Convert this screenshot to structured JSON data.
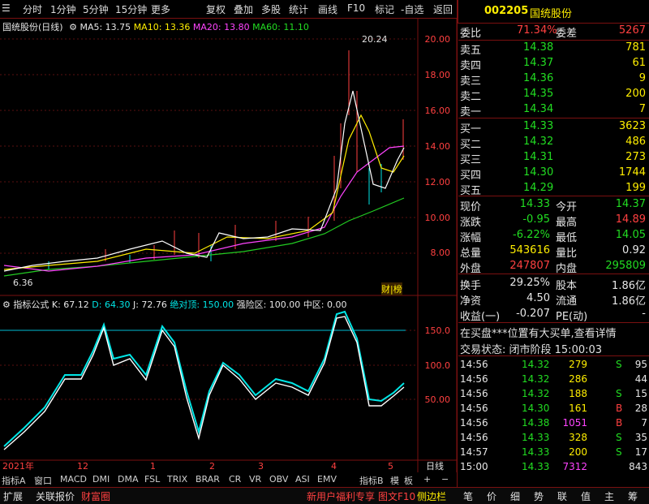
{
  "menu": {
    "items": [
      "分时",
      "1分钟",
      "5分钟",
      "15分钟",
      "更多",
      "复权",
      "叠加",
      "多股",
      "统计",
      "画线",
      "F10",
      "标记",
      "-自选",
      "返回"
    ]
  },
  "stock": {
    "code": "002205",
    "name": "国统股份"
  },
  "main_legend": {
    "title": "国统股份(日线)",
    "ma5": "MA5: 13.75",
    "ma10": "MA10: 13.36",
    "ma20": "MA20: 13.80",
    "ma60": "MA60: 11.10"
  },
  "price_axis": [
    "20.00",
    "18.00",
    "16.00",
    "14.00",
    "12.00",
    "10.00",
    "8.00"
  ],
  "price_marks": {
    "high": "20.24",
    "low": "6.36",
    "badge": "财|榜"
  },
  "ind_legend": {
    "name": "指标公式",
    "k": "K: 67.12",
    "d": "D: 64.30",
    "j": "J: 72.76",
    "top": "绝对顶: 150.00",
    "strong": "强险区: 100.00",
    "mid": "中区: 0.00"
  },
  "ind_axis": [
    "150.0",
    "100.0",
    "50.00"
  ],
  "time_axis": {
    "labels": [
      "2021年",
      "12",
      "1",
      "2",
      "3",
      "4",
      "5"
    ],
    "period": "日线"
  },
  "tabs": [
    "指标A",
    "窗口",
    "MACD",
    "DMI",
    "DMA",
    "FSL",
    "TRIX",
    "BRAR",
    "CR",
    "VR",
    "OBV",
    "ASI",
    "EMV",
    "指标B",
    "模",
    "板"
  ],
  "bottom": {
    "left": [
      "扩展",
      "关联报价",
      "财富圈"
    ],
    "mid": "新用户福利专享",
    "f10": "图文F10",
    "side": "侧边栏",
    "right": [
      "笔",
      "价",
      "细",
      "势",
      "联",
      "值",
      "主",
      "筹"
    ]
  },
  "order": {
    "wei_bi_label": "委比",
    "wei_bi": "71.34%",
    "wei_cha_label": "委差",
    "wei_cha": "5267",
    "asks": [
      {
        "l": "卖五",
        "p": "14.38",
        "v": "781"
      },
      {
        "l": "卖四",
        "p": "14.37",
        "v": "61"
      },
      {
        "l": "卖三",
        "p": "14.36",
        "v": "9"
      },
      {
        "l": "卖二",
        "p": "14.35",
        "v": "200"
      },
      {
        "l": "卖一",
        "p": "14.34",
        "v": "7"
      }
    ],
    "bids": [
      {
        "l": "买一",
        "p": "14.33",
        "v": "3623"
      },
      {
        "l": "买二",
        "p": "14.32",
        "v": "486"
      },
      {
        "l": "买三",
        "p": "14.31",
        "v": "273"
      },
      {
        "l": "买四",
        "p": "14.30",
        "v": "1744"
      },
      {
        "l": "买五",
        "p": "14.29",
        "v": "199"
      }
    ]
  },
  "quote": [
    {
      "a": "现价",
      "av": "14.33",
      "b": "今开",
      "bv": "14.37"
    },
    {
      "a": "涨跌",
      "av": "-0.95",
      "b": "最高",
      "bv": "14.89"
    },
    {
      "a": "涨幅",
      "av": "-6.22%",
      "b": "最低",
      "bv": "14.05"
    },
    {
      "a": "总量",
      "av": "543616",
      "b": "量比",
      "bv": "0.92"
    },
    {
      "a": "外盘",
      "av": "247807",
      "b": "内盘",
      "bv": "295809"
    }
  ],
  "stats": [
    {
      "a": "换手",
      "av": "29.25%",
      "b": "股本",
      "bv": "1.86亿"
    },
    {
      "a": "净资",
      "av": "4.50",
      "b": "流通",
      "bv": "1.86亿"
    },
    {
      "a": "收益(一)",
      "av": "-0.207",
      "b": "PE(动)",
      "bv": "-"
    }
  ],
  "notice": "在买盘***位置有大买单,查看详情",
  "status": "交易状态: 闭市阶段 15:00:03",
  "ticks": [
    {
      "t": "14:56",
      "p": "14.32",
      "v": "279",
      "s": "S",
      "n": "95"
    },
    {
      "t": "14:56",
      "p": "14.32",
      "v": "286",
      "s": "",
      "n": "44"
    },
    {
      "t": "14:56",
      "p": "14.32",
      "v": "188",
      "s": "S",
      "n": "15"
    },
    {
      "t": "14:56",
      "p": "14.30",
      "v": "161",
      "s": "B",
      "n": "28"
    },
    {
      "t": "14:56",
      "p": "14.38",
      "v": "1051",
      "s": "B",
      "n": "7"
    },
    {
      "t": "14:56",
      "p": "14.33",
      "v": "328",
      "s": "S",
      "n": "35"
    },
    {
      "t": "14:57",
      "p": "14.33",
      "v": "200",
      "s": "S",
      "n": "17"
    },
    {
      "t": "15:00",
      "p": "14.33",
      "v": "7312",
      "s": "",
      "n": "843"
    }
  ]
}
